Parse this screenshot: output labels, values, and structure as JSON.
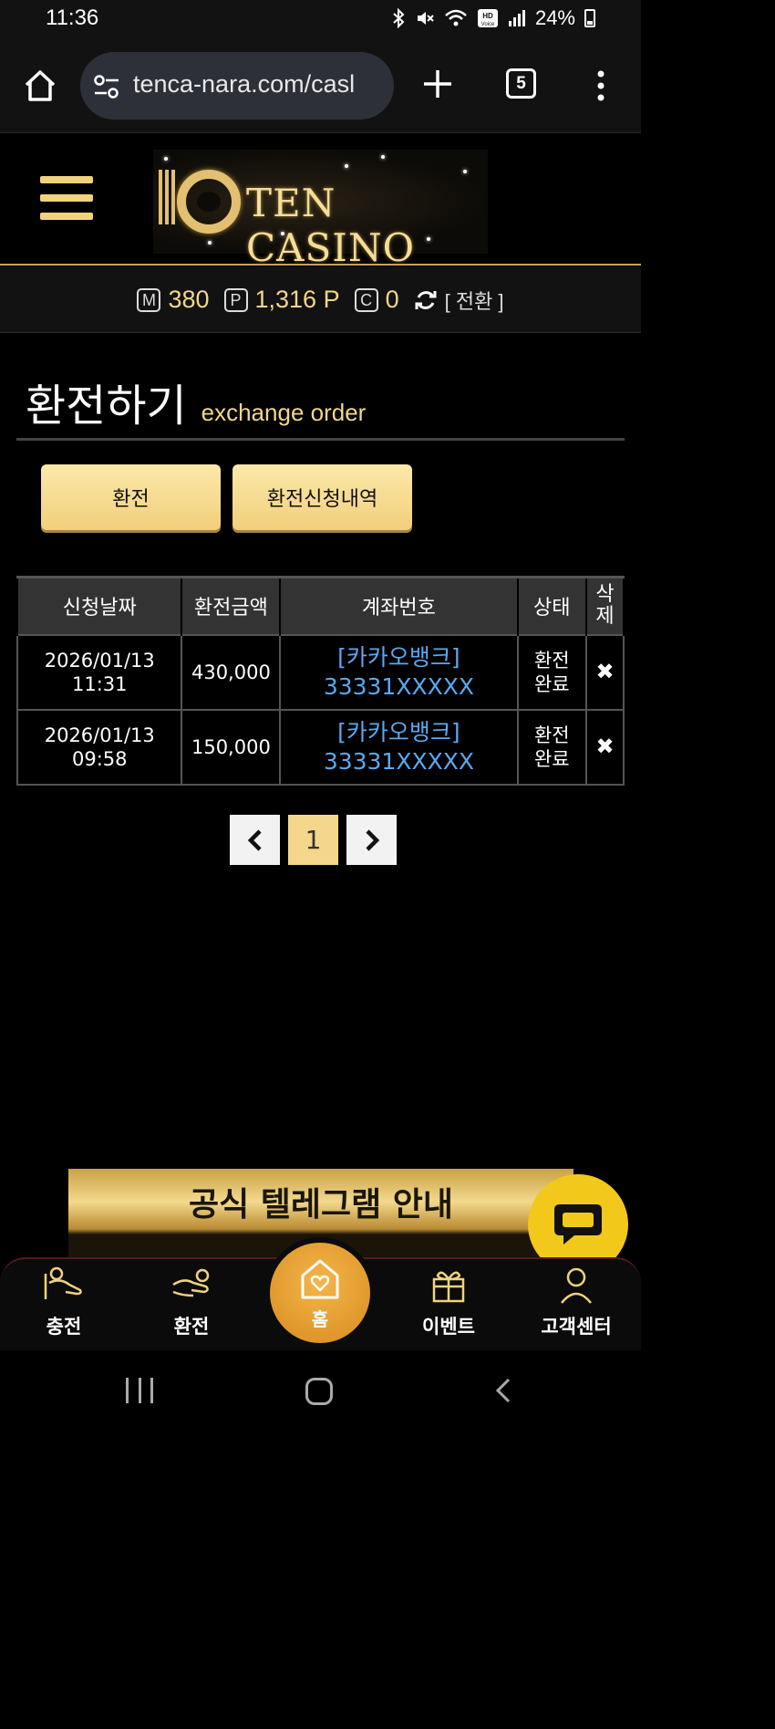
{
  "status_bar": {
    "time": "11:36",
    "battery": "24%"
  },
  "browser": {
    "url": "tenca-nara.com/casl",
    "tab_count": "5"
  },
  "site": {
    "brand": "TEN CASINO"
  },
  "points": {
    "m_label": "M",
    "m_value": "380",
    "p_label": "P",
    "p_value": "1,316 P",
    "c_label": "C",
    "c_value": "0",
    "convert_label": "[ 전환 ]"
  },
  "page": {
    "title_ko": "환전하기",
    "title_en": "exchange order"
  },
  "tabs": {
    "exchange": "환전",
    "history": "환전신청내역"
  },
  "table": {
    "headers": [
      "신청날짜",
      "환전금액",
      "계좌번호",
      "상태",
      "삭제"
    ],
    "rows": [
      {
        "date": "2026/01/13",
        "time": "11:31",
        "amount": "430,000",
        "bank": "[카카오뱅크]",
        "account": "33331XXXXX",
        "status1": "환전",
        "status2": "완료",
        "delete": "✖"
      },
      {
        "date": "2026/01/13",
        "time": "09:58",
        "amount": "150,000",
        "bank": "[카카오뱅크]",
        "account": "33331XXXXX",
        "status1": "환전",
        "status2": "완료",
        "delete": "✖"
      }
    ]
  },
  "pagination": {
    "prev": "‹",
    "current": "1",
    "next": "›"
  },
  "banner": {
    "text": "공식 텔레그램 안내"
  },
  "bottom_nav": {
    "charge": "충전",
    "exchange": "환전",
    "home": "홈",
    "event": "이벤트",
    "support": "고객센터"
  },
  "colors": {
    "gold": "#f3d68a",
    "link": "#5aa9f0",
    "home_orange": "#e49a2a",
    "chat_yellow": "#f2c81b"
  }
}
